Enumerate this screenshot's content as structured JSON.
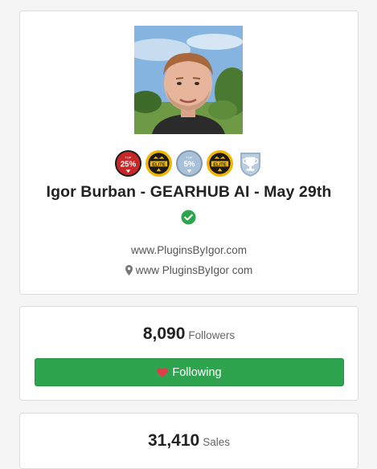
{
  "profile": {
    "name": "Igor Burban - GEARHUB AI - May 29th",
    "website": "www.PluginsByIgor.com",
    "location": "www PluginsByIgor com",
    "badges": [
      {
        "icon": "top-25-percent-badge-icon",
        "text": "25%",
        "top_text": "TOP",
        "color": "#c62828"
      },
      {
        "icon": "elite-badge-icon",
        "text": "ELITE",
        "color": "#f2b600"
      },
      {
        "icon": "top-5-percent-badge-icon",
        "text": "5%",
        "top_text": "TOP",
        "color": "#a9c1d8"
      },
      {
        "icon": "elite-badge-icon",
        "text": "ELITE",
        "color": "#f2b600"
      },
      {
        "icon": "trophy-badge-icon",
        "color": "#b9cde0"
      }
    ],
    "verified_color": "#2ea44f"
  },
  "followers": {
    "count": "8,090",
    "label": "Followers",
    "button_label": "Following",
    "button_color": "#2ea44f",
    "heart_color": "#e23b4b"
  },
  "sales": {
    "count": "31,410",
    "label": "Sales"
  }
}
